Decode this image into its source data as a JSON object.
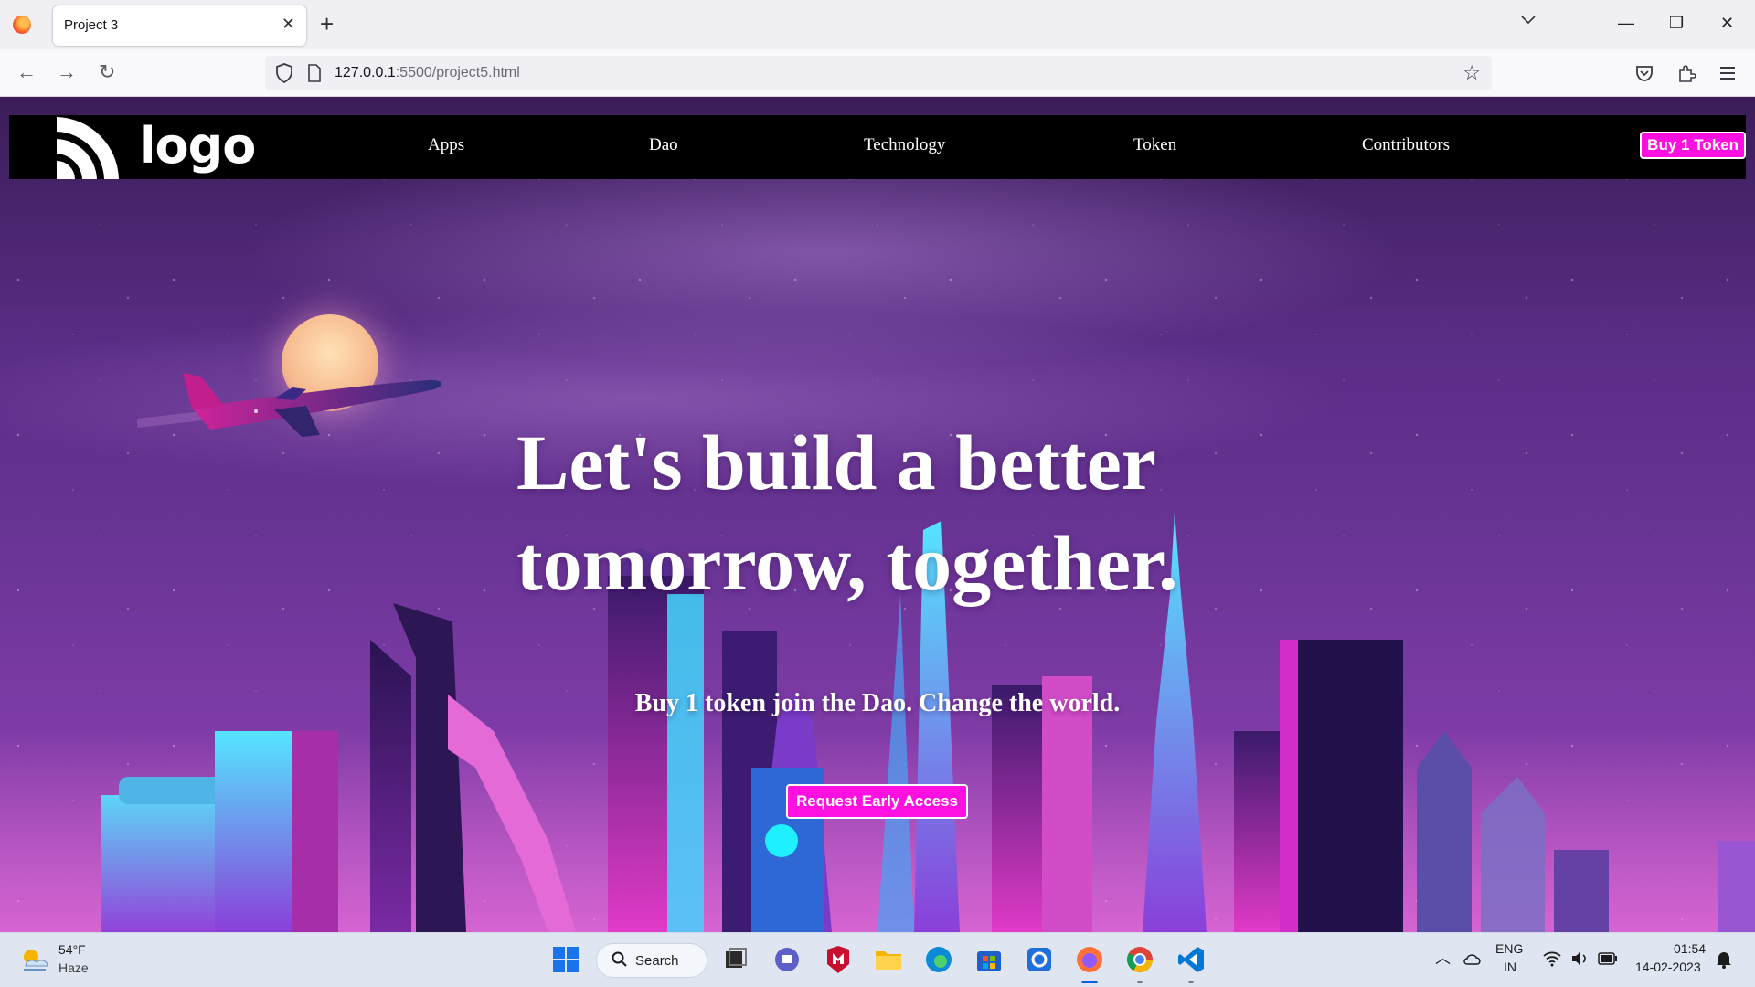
{
  "browser": {
    "tab_title": "Project 3",
    "tab_close": "✕",
    "new_tab": "+",
    "url_host": "127.0.0.1",
    "url_path": ":5500/project5.html",
    "window_controls": {
      "minimize": "—",
      "restore": "❐",
      "close": "✕"
    }
  },
  "site": {
    "logo_text": "logo",
    "menu": [
      "Apps",
      "Dao",
      "Technology",
      "Token",
      "Contributors"
    ],
    "buy_button": "Buy 1 Token",
    "hero_title_line1": "Let's build a better",
    "hero_title_line2": "tomorrow, together.",
    "hero_subtitle": "Buy 1 token join the Dao. Change the world.",
    "cta_button": "Request Early Access",
    "accent_color": "#ff10e0"
  },
  "taskbar": {
    "weather_temp": "54°F",
    "weather_desc": "Haze",
    "search_label": "Search",
    "language_line1": "ENG",
    "language_line2": "IN",
    "time": "01:54",
    "date": "14-02-2023",
    "apps": [
      "start",
      "search",
      "task-view",
      "teams-chat",
      "mcafee",
      "file-explorer",
      "edge",
      "microsoft-store",
      "app",
      "firefox",
      "chrome",
      "vscode"
    ]
  }
}
